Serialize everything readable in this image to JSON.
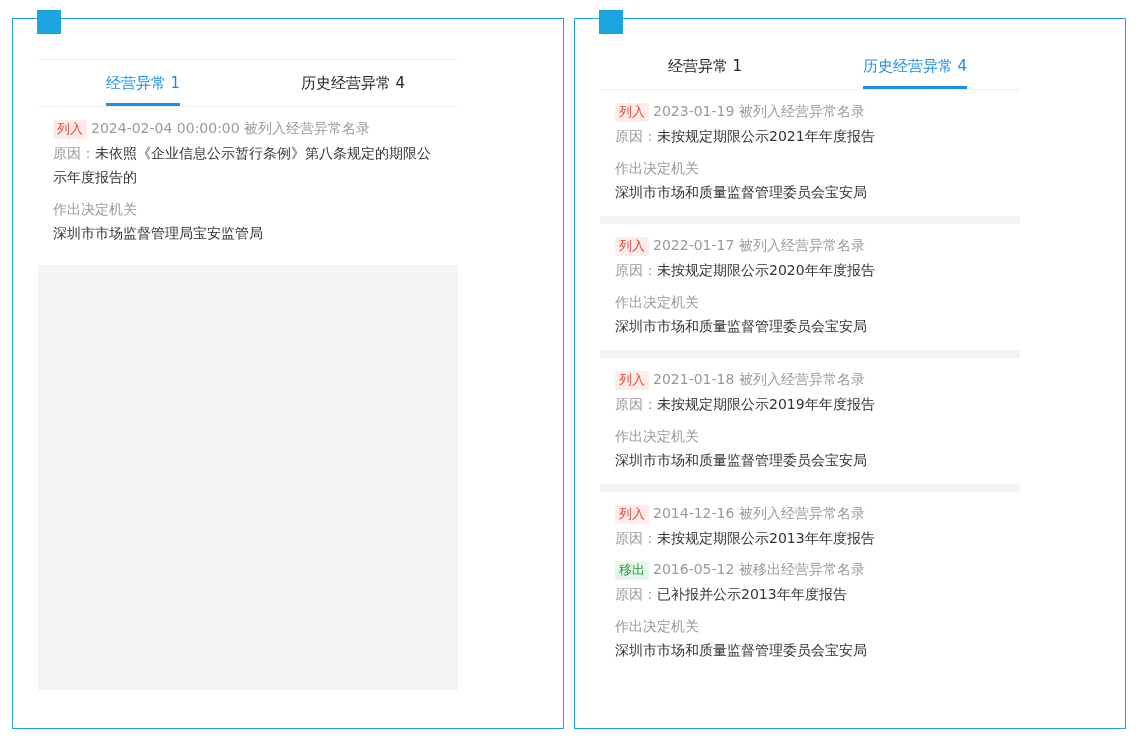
{
  "panels": [
    {
      "filler": true,
      "tabs": [
        {
          "label": "经营异常 1",
          "selected": true
        },
        {
          "label": "历史经营异常 4",
          "selected": false
        }
      ],
      "records": [
        {
          "events": [
            {
              "kind": "in",
              "tag": "列入",
              "text": "2024-02-04 00:00:00 被列入经营异常名录",
              "reason_label": "原因：",
              "reason": "未依照《企业信息公示暂行条例》第八条规定的期限公示年度报告的"
            }
          ],
          "authority_label": "作出决定机关",
          "authority": "深圳市市场监督管理局宝安监管局"
        }
      ]
    },
    {
      "filler": false,
      "tabs": [
        {
          "label": "经营异常 1",
          "selected": false
        },
        {
          "label": "历史经营异常 4",
          "selected": true
        }
      ],
      "records": [
        {
          "events": [
            {
              "kind": "in",
              "tag": "列入",
              "text": "2023-01-19 被列入经营异常名录",
              "reason_label": "原因：",
              "reason": "未按规定期限公示2021年年度报告"
            }
          ],
          "authority_label": "作出决定机关",
          "authority": "深圳市市场和质量监督管理委员会宝安局"
        },
        {
          "events": [
            {
              "kind": "in",
              "tag": "列入",
              "text": "2022-01-17 被列入经营异常名录",
              "reason_label": "原因：",
              "reason": "未按规定期限公示2020年年度报告"
            }
          ],
          "authority_label": "作出决定机关",
          "authority": "深圳市市场和质量监督管理委员会宝安局"
        },
        {
          "events": [
            {
              "kind": "in",
              "tag": "列入",
              "text": "2021-01-18 被列入经营异常名录",
              "reason_label": "原因：",
              "reason": "未按规定期限公示2019年年度报告"
            }
          ],
          "authority_label": "作出决定机关",
          "authority": "深圳市市场和质量监督管理委员会宝安局"
        },
        {
          "events": [
            {
              "kind": "in",
              "tag": "列入",
              "text": "2014-12-16 被列入经营异常名录",
              "reason_label": "原因：",
              "reason": "未按规定期限公示2013年年度报告"
            },
            {
              "kind": "out",
              "tag": "移出",
              "text": "2016-05-12 被移出经营异常名录",
              "reason_label": "原因：",
              "reason": "已补报并公示2013年年度报告"
            }
          ],
          "authority_label": "作出决定机关",
          "authority": "深圳市市场和质量监督管理委员会宝安局"
        }
      ]
    }
  ]
}
